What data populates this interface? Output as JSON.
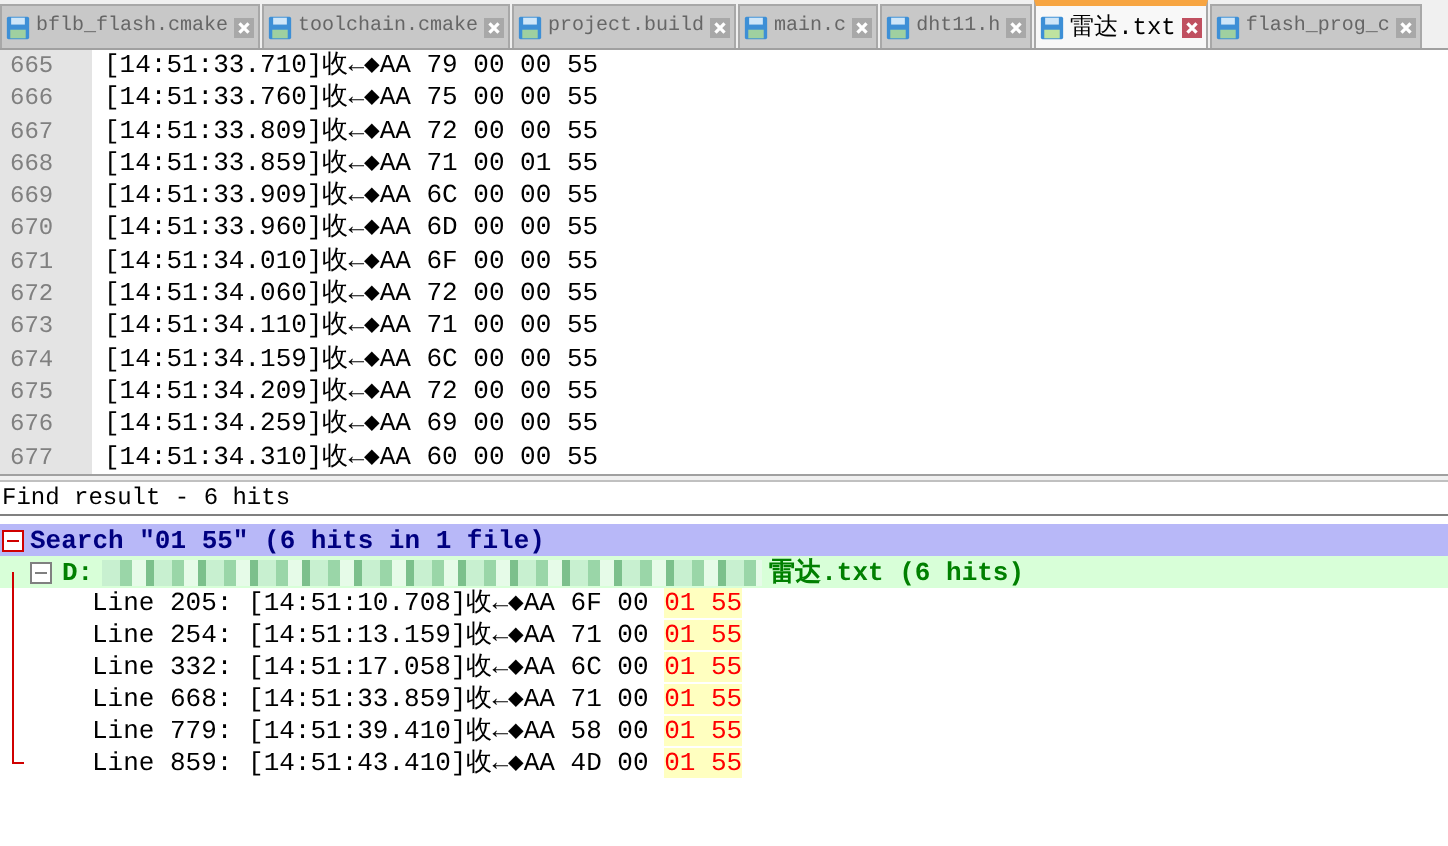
{
  "tabs": [
    {
      "label": "bflb_flash.cmake",
      "selected": false
    },
    {
      "label": "toolchain.cmake",
      "selected": false
    },
    {
      "label": "project.build",
      "selected": false
    },
    {
      "label": "main.c",
      "selected": false
    },
    {
      "label": "dht11.h",
      "selected": false
    },
    {
      "label": "雷达.txt",
      "selected": true
    },
    {
      "label": "flash_prog_c",
      "selected": false
    }
  ],
  "editor": {
    "lines": [
      {
        "number": "665",
        "text": "[14:51:33.710]收←◆AA 79 00 00 55"
      },
      {
        "number": "666",
        "text": "[14:51:33.760]收←◆AA 75 00 00 55"
      },
      {
        "number": "667",
        "text": "[14:51:33.809]收←◆AA 72 00 00 55"
      },
      {
        "number": "668",
        "text": "[14:51:33.859]收←◆AA 71 00 01 55"
      },
      {
        "number": "669",
        "text": "[14:51:33.909]收←◆AA 6C 00 00 55"
      },
      {
        "number": "670",
        "text": "[14:51:33.960]收←◆AA 6D 00 00 55"
      },
      {
        "number": "671",
        "text": "[14:51:34.010]收←◆AA 6F 00 00 55"
      },
      {
        "number": "672",
        "text": "[14:51:34.060]收←◆AA 72 00 00 55"
      },
      {
        "number": "673",
        "text": "[14:51:34.110]收←◆AA 71 00 00 55"
      },
      {
        "number": "674",
        "text": "[14:51:34.159]收←◆AA 6C 00 00 55"
      },
      {
        "number": "675",
        "text": "[14:51:34.209]收←◆AA 72 00 00 55"
      },
      {
        "number": "676",
        "text": "[14:51:34.259]收←◆AA 69 00 00 55"
      },
      {
        "number": "677",
        "text": "[14:51:34.310]收←◆AA 60 00 00 55"
      }
    ]
  },
  "find_result": {
    "title": "Find result - 6 hits",
    "search": {
      "label": "Search \"01 55\" (6 hits in 1 file)",
      "expanded": true,
      "file": {
        "path_start": "D:",
        "path_end": "雷达.txt (6 hits)",
        "expanded": true,
        "hits": [
          {
            "prefix": "Line 205: [14:51:10.708]收←◆AA 6F 00 ",
            "match": "01 55"
          },
          {
            "prefix": "Line 254: [14:51:13.159]收←◆AA 71 00 ",
            "match": "01 55"
          },
          {
            "prefix": "Line 332: [14:51:17.058]收←◆AA 6C 00 ",
            "match": "01 55"
          },
          {
            "prefix": "Line 668: [14:51:33.859]收←◆AA 71 00 ",
            "match": "01 55"
          },
          {
            "prefix": "Line 779: [14:51:39.410]收←◆AA 58 00 ",
            "match": "01 55"
          },
          {
            "prefix": "Line 859: [14:51:43.410]收←◆AA 4D 00 ",
            "match": "01 55"
          }
        ]
      }
    }
  }
}
